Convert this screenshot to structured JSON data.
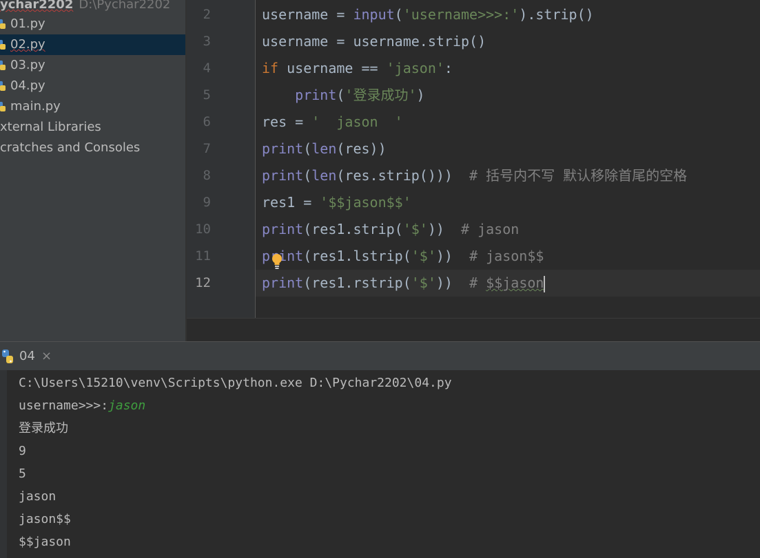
{
  "project": {
    "root_name": "ychar2202",
    "root_path": "D:\\Pychar2202",
    "files": [
      {
        "name": "01.py",
        "selected": false,
        "error": false
      },
      {
        "name": "02.py",
        "selected": true,
        "error": true
      },
      {
        "name": "03.py",
        "selected": false,
        "error": false
      },
      {
        "name": "04.py",
        "selected": false,
        "error": false
      },
      {
        "name": "main.py",
        "selected": false,
        "error": false
      }
    ],
    "external_libraries": "xternal Libraries",
    "scratches": "cratches and Consoles"
  },
  "editor": {
    "line_numbers": [
      "2",
      "3",
      "4",
      "5",
      "6",
      "7",
      "8",
      "9",
      "10",
      "11",
      "12"
    ],
    "current_line": "12",
    "lines": [
      [
        {
          "t": "username = ",
          "c": "fn"
        },
        {
          "t": "input",
          "c": "bi"
        },
        {
          "t": "(",
          "c": "fn"
        },
        {
          "t": "'username>>>:'",
          "c": "str"
        },
        {
          "t": ").strip()",
          "c": "fn"
        }
      ],
      [
        {
          "t": "username = username.strip()",
          "c": "fn"
        }
      ],
      [
        {
          "t": "if ",
          "c": "kw"
        },
        {
          "t": "username == ",
          "c": "fn"
        },
        {
          "t": "'jason'",
          "c": "str"
        },
        {
          "t": ":",
          "c": "fn"
        }
      ],
      [
        {
          "t": "    ",
          "c": "fn"
        },
        {
          "t": "print",
          "c": "bi"
        },
        {
          "t": "(",
          "c": "fn"
        },
        {
          "t": "'登录成功'",
          "c": "str"
        },
        {
          "t": ")",
          "c": "fn"
        }
      ],
      [
        {
          "t": "res = ",
          "c": "fn"
        },
        {
          "t": "'  jason  '",
          "c": "str"
        }
      ],
      [
        {
          "t": "print",
          "c": "bi"
        },
        {
          "t": "(",
          "c": "fn"
        },
        {
          "t": "len",
          "c": "bi"
        },
        {
          "t": "(res))",
          "c": "fn"
        }
      ],
      [
        {
          "t": "print",
          "c": "bi"
        },
        {
          "t": "(",
          "c": "fn"
        },
        {
          "t": "len",
          "c": "bi"
        },
        {
          "t": "(res.strip()))  ",
          "c": "fn"
        },
        {
          "t": "# 括号内不写 默认移除首尾的空格",
          "c": "cmt"
        }
      ],
      [
        {
          "t": "res1 = ",
          "c": "fn"
        },
        {
          "t": "'$$jason$$'",
          "c": "str"
        }
      ],
      [
        {
          "t": "print",
          "c": "bi"
        },
        {
          "t": "(res1.strip(",
          "c": "fn"
        },
        {
          "t": "'$'",
          "c": "str"
        },
        {
          "t": "))  ",
          "c": "fn"
        },
        {
          "t": "# jason",
          "c": "cmt"
        }
      ],
      [
        {
          "t": "print",
          "c": "bi"
        },
        {
          "t": "(res1.lstrip(",
          "c": "fn"
        },
        {
          "t": "'$'",
          "c": "str"
        },
        {
          "t": "))  ",
          "c": "fn"
        },
        {
          "t": "# jason$$",
          "c": "cmt"
        }
      ],
      [
        {
          "t": "print",
          "c": "bi"
        },
        {
          "t": "(res1.rstrip(",
          "c": "fn"
        },
        {
          "t": "'$'",
          "c": "str"
        },
        {
          "t": "))  ",
          "c": "fn"
        },
        {
          "t": "# ",
          "c": "cmt"
        },
        {
          "t": "$$jason",
          "c": "cmt wavy"
        }
      ]
    ]
  },
  "run": {
    "tab_label": "04",
    "close_glyph": "×",
    "console": [
      {
        "text": "C:\\Users\\15210\\venv\\Scripts\\python.exe D:\\Pychar2202\\04.py"
      },
      {
        "text": "username>>>:",
        "input": "jason"
      },
      {
        "text": "登录成功"
      },
      {
        "text": "9"
      },
      {
        "text": "5"
      },
      {
        "text": "jason"
      },
      {
        "text": "jason$$"
      },
      {
        "text": "$$jason"
      }
    ]
  },
  "colors": {
    "keyword": "#cc7832",
    "builtin": "#8888c6",
    "string": "#6a8759",
    "comment": "#808080",
    "selection": "#0d293e",
    "console_input": "#3f9e3f"
  },
  "icons": {
    "file": "python-file-icon",
    "intention": "lightbulb-icon",
    "run_tab": "python-icon",
    "close": "close-icon"
  }
}
